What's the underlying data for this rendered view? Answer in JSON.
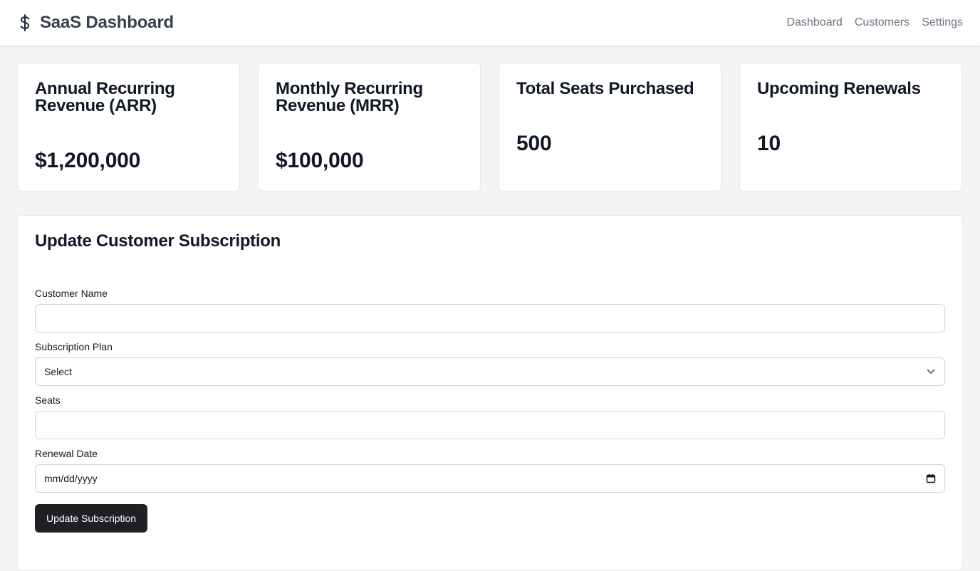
{
  "header": {
    "title": "SaaS Dashboard",
    "brand_icon": "dollar-sign-icon",
    "nav": [
      {
        "label": "Dashboard"
      },
      {
        "label": "Customers"
      },
      {
        "label": "Settings"
      }
    ]
  },
  "metrics": [
    {
      "title": "Annual Recurring Revenue (ARR)",
      "value": "$1,200,000"
    },
    {
      "title": "Monthly Recurring Revenue (MRR)",
      "value": "$100,000"
    },
    {
      "title": "Total Seats Purchased",
      "value": "500"
    },
    {
      "title": "Upcoming Renewals",
      "value": "10"
    }
  ],
  "form": {
    "title": "Update Customer Subscription",
    "customer_name": {
      "label": "Customer Name",
      "value": ""
    },
    "plan": {
      "label": "Subscription Plan",
      "selected": "Select"
    },
    "seats": {
      "label": "Seats",
      "value": ""
    },
    "renewal_date": {
      "label": "Renewal Date",
      "placeholder": "mm/dd/yyyy"
    },
    "submit_label": "Update Subscription"
  },
  "colors": {
    "background": "#f3f4f6",
    "button": "#1f2023",
    "nav_text": "#6b7280"
  }
}
